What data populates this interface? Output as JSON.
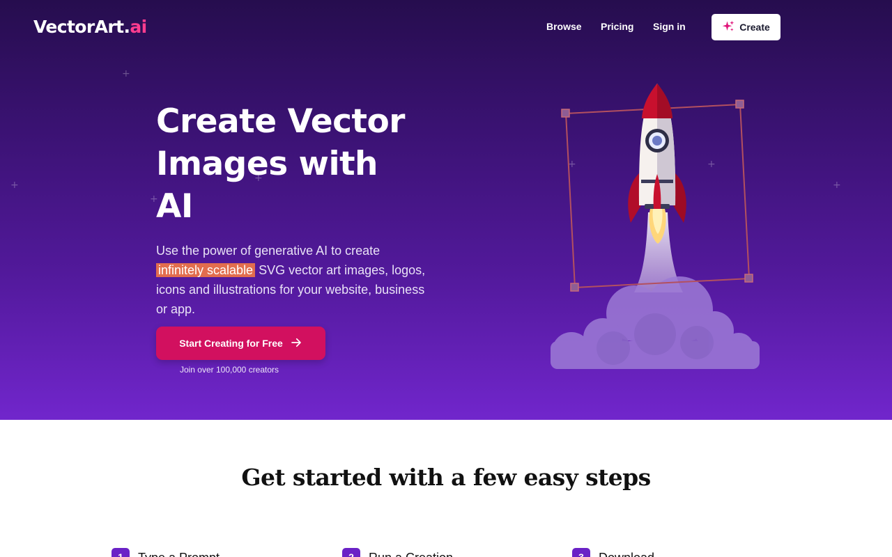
{
  "brand": {
    "name": "VectorArt.",
    "suffix": "ai"
  },
  "nav": {
    "browse": "Browse",
    "pricing": "Pricing",
    "sign_in": "Sign in",
    "create": "Create"
  },
  "hero": {
    "headline": "Create Vector Images with AI",
    "subtitle_pre": "Use the power of generative AI to create ",
    "subtitle_highlight": "infinitely scalable",
    "subtitle_post": " SVG vector art images, logos, icons and illustrations for your website, business or app.",
    "cta": "Start Creating for Free",
    "cta_note": "Join over 100,000 creators"
  },
  "steps": {
    "title": "Get started with a few easy steps",
    "items": [
      {
        "number": "1",
        "label": "Type a Prompt"
      },
      {
        "number": "2",
        "label": "Run a Creation"
      },
      {
        "number": "3",
        "label": "Download"
      }
    ]
  },
  "icons": {
    "create": "sparkle-icon",
    "cta": "arrow-right-icon"
  },
  "colors": {
    "hero_top": "#260d4e",
    "hero_bottom": "#7126cc",
    "brand_accent": "#ff3d8f",
    "cta": "#d2105f",
    "highlight": "#e26d4e",
    "step_badge": "#6a22c6",
    "rocket_red": "#c8102e"
  }
}
